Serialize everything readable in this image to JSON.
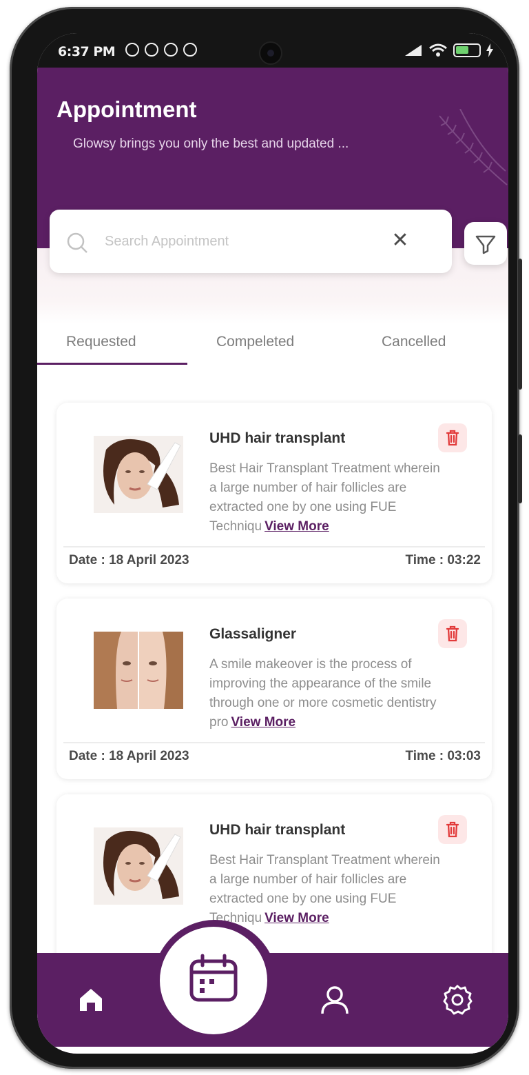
{
  "status_bar": {
    "time": "6:37 PM",
    "battery": "61"
  },
  "header": {
    "title": "Appointment",
    "subtitle": "Glowsy brings you only the best and updated ..."
  },
  "search": {
    "placeholder": "Search Appointment",
    "value": ""
  },
  "tabs": [
    {
      "label": "Requested",
      "active": true
    },
    {
      "label": "Compeleted",
      "active": false
    },
    {
      "label": "Cancelled",
      "active": false
    }
  ],
  "appointments": [
    {
      "title": "UHD hair transplant",
      "description": "Best Hair Transplant Treatment wherein a large number of hair follicles are extracted one by one using FUE Techniqu",
      "view_more": "View More",
      "date": "Date : 18 April 2023",
      "time": "Time : 03:22",
      "image": "woman-face-photo"
    },
    {
      "title": "Glassaligner",
      "description": "A smile makeover is the process of improving the appearance of the smile through one or more cosmetic dentistry pro",
      "view_more": "View More",
      "date": "Date : 18 April 2023",
      "time": "Time : 03:03",
      "image": "face-before-after-photo"
    },
    {
      "title": "UHD hair transplant",
      "description": "Best Hair Transplant Treatment wherein a large number of hair follicles are extracted one by one using FUE Techniqu",
      "view_more": "View More",
      "image": "woman-face-photo"
    }
  ],
  "nav": {
    "items": [
      "home-icon",
      "calendar-icon",
      "profile-icon",
      "settings-icon"
    ],
    "active": "calendar-icon"
  },
  "colors": {
    "primary": "#5b1f63",
    "delete_bg": "#fde7e7",
    "delete_icon": "#e23b3b",
    "muted_text": "#8d8d8d"
  }
}
